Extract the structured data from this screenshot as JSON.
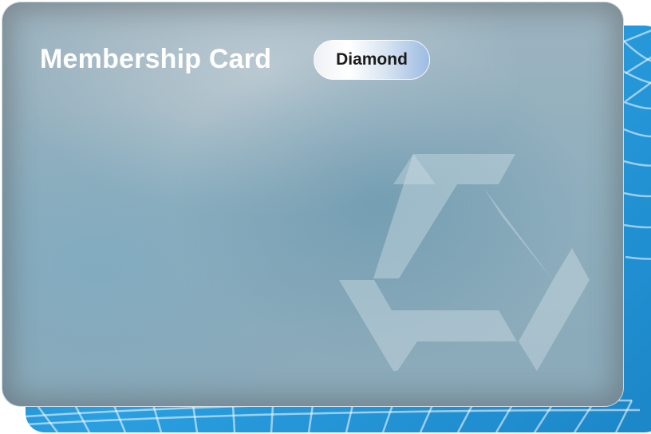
{
  "card": {
    "title": "Membership Card",
    "tier": "Diamond"
  },
  "colors": {
    "back_card": "#1b86c8",
    "front_card": "#8eaebd",
    "badge_accent": "#9cbbe2",
    "title_text": "#ffffff",
    "badge_text": "#1b1b1b"
  },
  "icons": {
    "logo": "triangle-logo-icon",
    "pattern": "wave-line-pattern"
  }
}
